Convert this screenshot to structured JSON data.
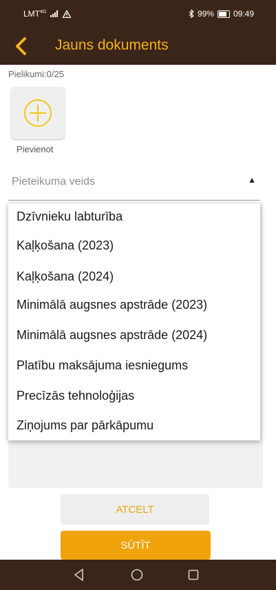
{
  "status_bar": {
    "carrier": "LMT",
    "carrier_sup": "4G",
    "battery": "99%",
    "time": "09:49"
  },
  "app_bar": {
    "title": "Jauns dokuments"
  },
  "attachments": {
    "count_label": "Pielikumi:0/25",
    "add_label": "Pievienot"
  },
  "application_type": {
    "placeholder": "Pieteikuma veids",
    "options": [
      "Dzīvnieku labturība",
      "Kaļķošana (2023)",
      "Kaļķošana (2024)",
      "Minimālā augsnes apstrāde (2023)",
      "Minimālā augsnes apstrāde (2024)",
      "Platību maksājuma iesniegums",
      "Precīzās tehnoloģijas",
      "Ziņojums par pārkāpumu"
    ]
  },
  "buttons": {
    "cancel": "ATCELT",
    "send": "SŪTĪT"
  },
  "colors": {
    "bar_background": "#3b2418",
    "accent": "#f2b319",
    "send_button": "#f0a30a"
  }
}
